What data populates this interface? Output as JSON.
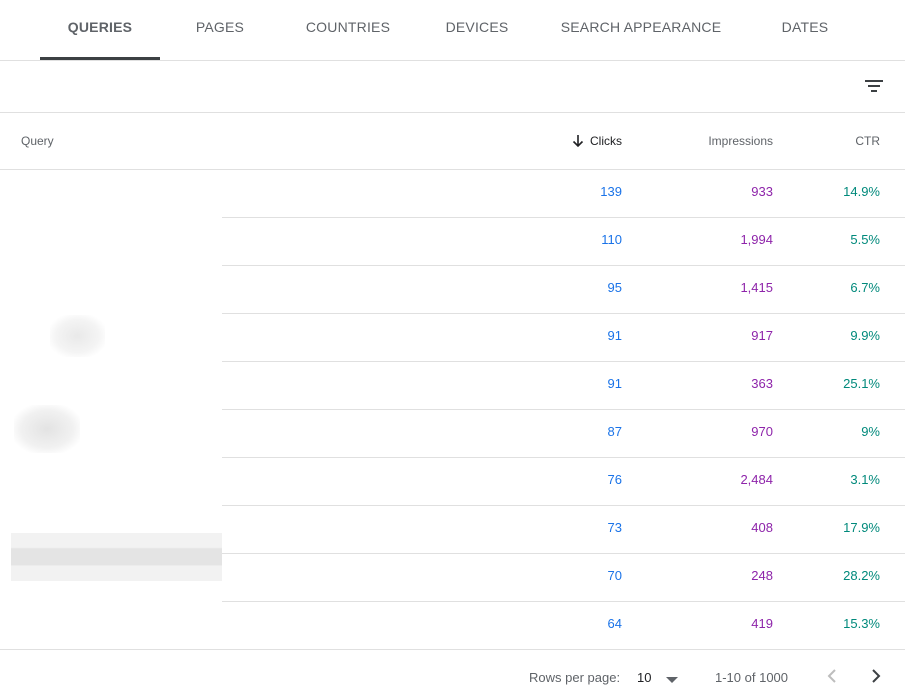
{
  "tabs": [
    {
      "label": "QUERIES",
      "active": true
    },
    {
      "label": "PAGES"
    },
    {
      "label": "COUNTRIES"
    },
    {
      "label": "DEVICES"
    },
    {
      "label": "SEARCH APPEARANCE"
    },
    {
      "label": "DATES"
    }
  ],
  "toolbar": {
    "filter_icon": "filter-icon"
  },
  "table": {
    "headers": {
      "query": "Query",
      "clicks": "Clicks",
      "impressions": "Impressions",
      "ctr": "CTR"
    },
    "sort_icon": "arrow-down-icon",
    "rows": [
      {
        "clicks": "139",
        "impressions": "933",
        "ctr": "14.9%"
      },
      {
        "clicks": "110",
        "impressions": "1,994",
        "ctr": "5.5%"
      },
      {
        "clicks": "95",
        "impressions": "1,415",
        "ctr": "6.7%"
      },
      {
        "clicks": "91",
        "impressions": "917",
        "ctr": "9.9%"
      },
      {
        "clicks": "91",
        "impressions": "363",
        "ctr": "25.1%"
      },
      {
        "clicks": "87",
        "impressions": "970",
        "ctr": "9%"
      },
      {
        "clicks": "76",
        "impressions": "2,484",
        "ctr": "3.1%"
      },
      {
        "clicks": "73",
        "impressions": "408",
        "ctr": "17.9%"
      },
      {
        "clicks": "70",
        "impressions": "248",
        "ctr": "28.2%"
      },
      {
        "clicks": "64",
        "impressions": "419",
        "ctr": "15.3%"
      }
    ]
  },
  "footer": {
    "rows_per_page_label": "Rows per page:",
    "rows_per_page_value": "10",
    "range": "1-10 of 1000"
  },
  "colors": {
    "clicks": "#1a73e8",
    "impressions": "#8e24aa",
    "ctr": "#00897b"
  }
}
